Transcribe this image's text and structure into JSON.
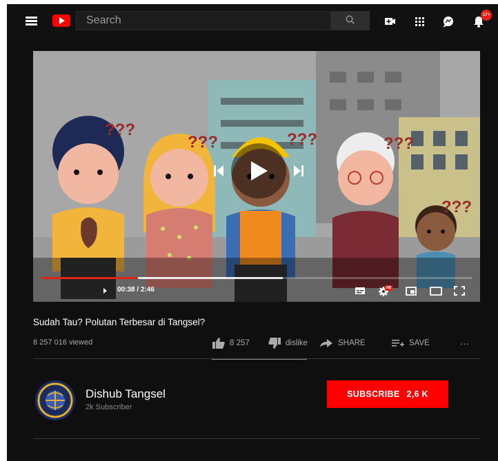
{
  "topbar": {
    "search_placeholder": "Search",
    "notification_count": "17+"
  },
  "player": {
    "time": "00:38 / 2:46",
    "progress_played_fraction": 0.224,
    "progress_buffered_fraction": 0.561,
    "overlay_text": [
      "???",
      "???",
      "???",
      "???",
      "???"
    ],
    "hd_label": "HD"
  },
  "video": {
    "title": "Sudah Tau? Polutan Terbesar di Tangsel?",
    "views": "8 257 016 viewed",
    "like_count": "8 257",
    "dislike_label": "dislike",
    "share_label": "SHARE",
    "save_label": "SAVE",
    "more_label": "..."
  },
  "channel": {
    "name": "Dishub Tangsel",
    "subscribers": "2k Subscriber",
    "subscribe_label": "SUBSCRIBE",
    "subscribe_count": "2,6 K"
  },
  "colors": {
    "accent": "#ff0000",
    "background": "#0f0f0f"
  }
}
